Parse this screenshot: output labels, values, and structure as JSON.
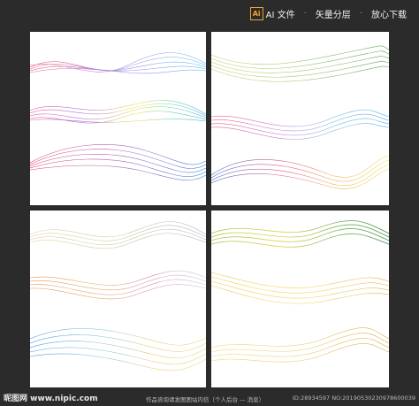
{
  "topbar": {
    "format_badge": "Ai",
    "format_label": "AI 文件",
    "item2": "矢量分层",
    "item3": "放心下载"
  },
  "footer": {
    "site": "昵图网 www.nipic.com",
    "notice": "作品咨询请发图图站内信（个人后台 — 消息）",
    "id": "ID:28934597 NO:20190530230978600039"
  },
  "colors": {
    "background": "#2b2b2b",
    "panel": "#ffffff",
    "accent": "#f0a030"
  }
}
